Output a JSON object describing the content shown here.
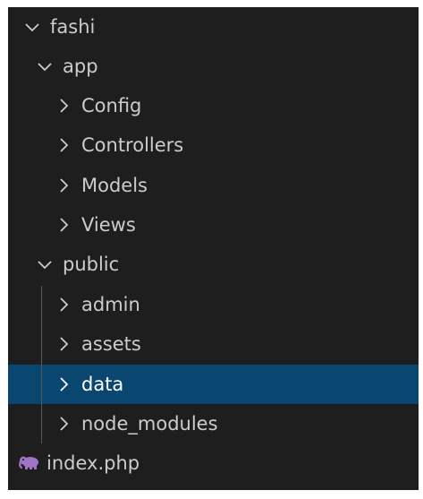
{
  "explorer": {
    "colors": {
      "background": "#1e1e1e",
      "text": "#cccccc",
      "selected_bg": "#094771",
      "indent_guide": "#585858",
      "php_icon": "#a074c4"
    },
    "tree": {
      "root": {
        "label": "fashi",
        "expanded": true,
        "icon": "chevron-down-icon"
      },
      "app": {
        "label": "app",
        "expanded": true,
        "icon": "chevron-down-icon"
      },
      "config": {
        "label": "Config",
        "expanded": false,
        "icon": "chevron-right-icon"
      },
      "controllers": {
        "label": "Controllers",
        "expanded": false,
        "icon": "chevron-right-icon"
      },
      "models": {
        "label": "Models",
        "expanded": false,
        "icon": "chevron-right-icon"
      },
      "views": {
        "label": "Views",
        "expanded": false,
        "icon": "chevron-right-icon"
      },
      "public": {
        "label": "public",
        "expanded": true,
        "icon": "chevron-down-icon"
      },
      "admin": {
        "label": "admin",
        "expanded": false,
        "icon": "chevron-right-icon"
      },
      "assets": {
        "label": "assets",
        "expanded": false,
        "icon": "chevron-right-icon"
      },
      "data": {
        "label": "data",
        "expanded": false,
        "selected": true,
        "icon": "chevron-right-icon"
      },
      "node_modules": {
        "label": "node_modules",
        "expanded": false,
        "icon": "chevron-right-icon"
      },
      "index_php": {
        "label": "index.php",
        "icon": "php-elephant-icon"
      }
    }
  }
}
